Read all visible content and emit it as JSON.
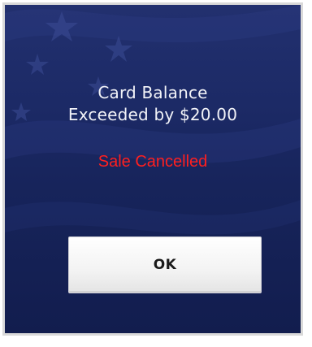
{
  "dialog": {
    "message_line1": "Card Balance",
    "message_line2": "Exceeded by $20.00",
    "status_text": "Sale Cancelled",
    "ok_label": "OK"
  },
  "colors": {
    "background_blue": "#1c2a66",
    "message_text": "#f2f3f8",
    "status_red": "#ff1f1f",
    "button_face": "#f3f3f3"
  },
  "background_image": "american-flag"
}
